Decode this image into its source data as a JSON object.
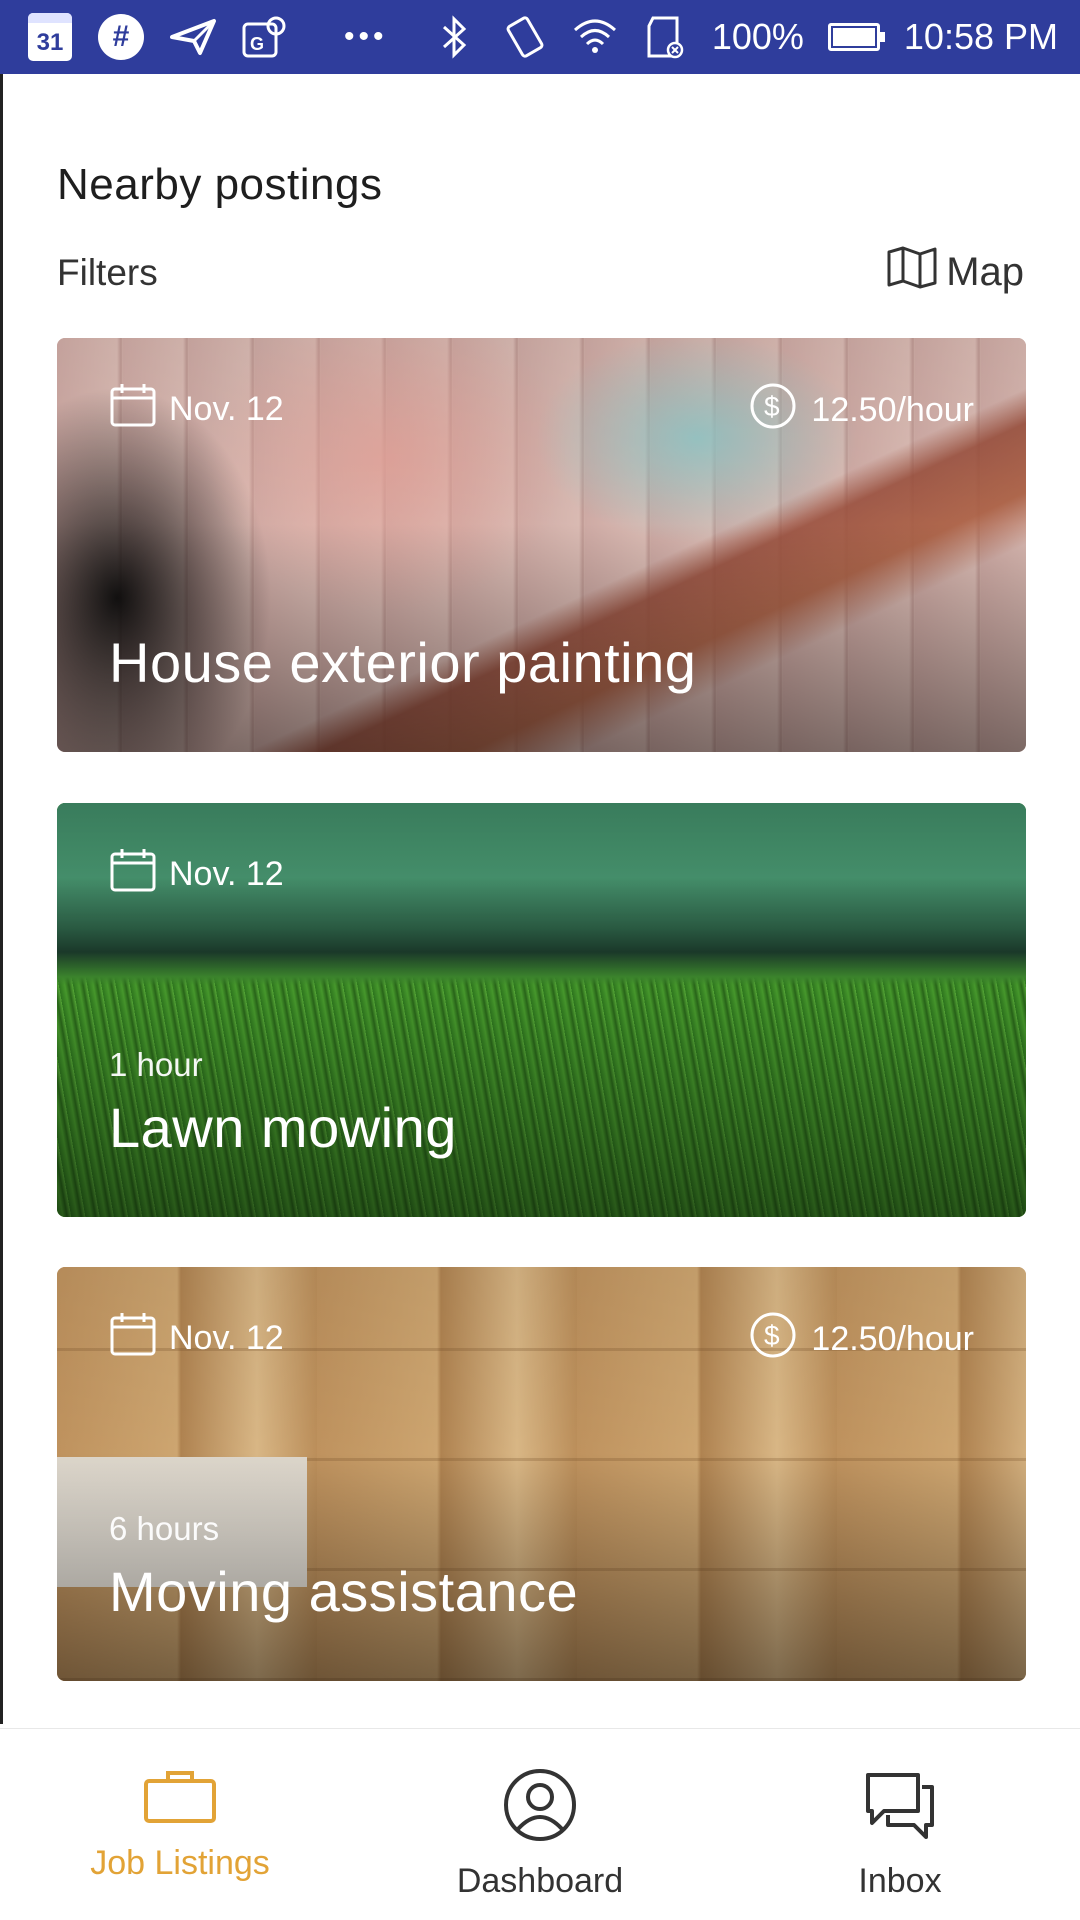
{
  "status_bar": {
    "calendar_day": "31",
    "battery": "100%",
    "time": "10:58 PM",
    "icons": [
      "calendar-icon",
      "slack-icon",
      "send-icon",
      "maps-icon",
      "more-dots-icon",
      "bluetooth-icon",
      "vibrate-icon",
      "wifi-icon",
      "sd-card-icon",
      "battery-icon"
    ]
  },
  "header": {
    "title": "Nearby postings",
    "filters_label": "Filters",
    "map_label": "Map"
  },
  "listings": [
    {
      "date": "Nov. 12",
      "pay": "12.50/hour",
      "duration": "",
      "title": "House exterior painting"
    },
    {
      "date": "Nov. 12",
      "pay": "",
      "duration": "1 hour",
      "title": "Lawn mowing"
    },
    {
      "date": "Nov. 12",
      "pay": "12.50/hour",
      "duration": "6 hours",
      "title": "Moving assistance"
    }
  ],
  "bottom_nav": {
    "items": [
      {
        "label": "Job Listings",
        "icon": "briefcase-icon",
        "active": true
      },
      {
        "label": "Dashboard",
        "icon": "user-circle-icon",
        "active": false
      },
      {
        "label": "Inbox",
        "icon": "chat-icon",
        "active": false
      }
    ]
  },
  "colors": {
    "status_bar": "#2f3d9c",
    "accent": "#e2a336"
  }
}
